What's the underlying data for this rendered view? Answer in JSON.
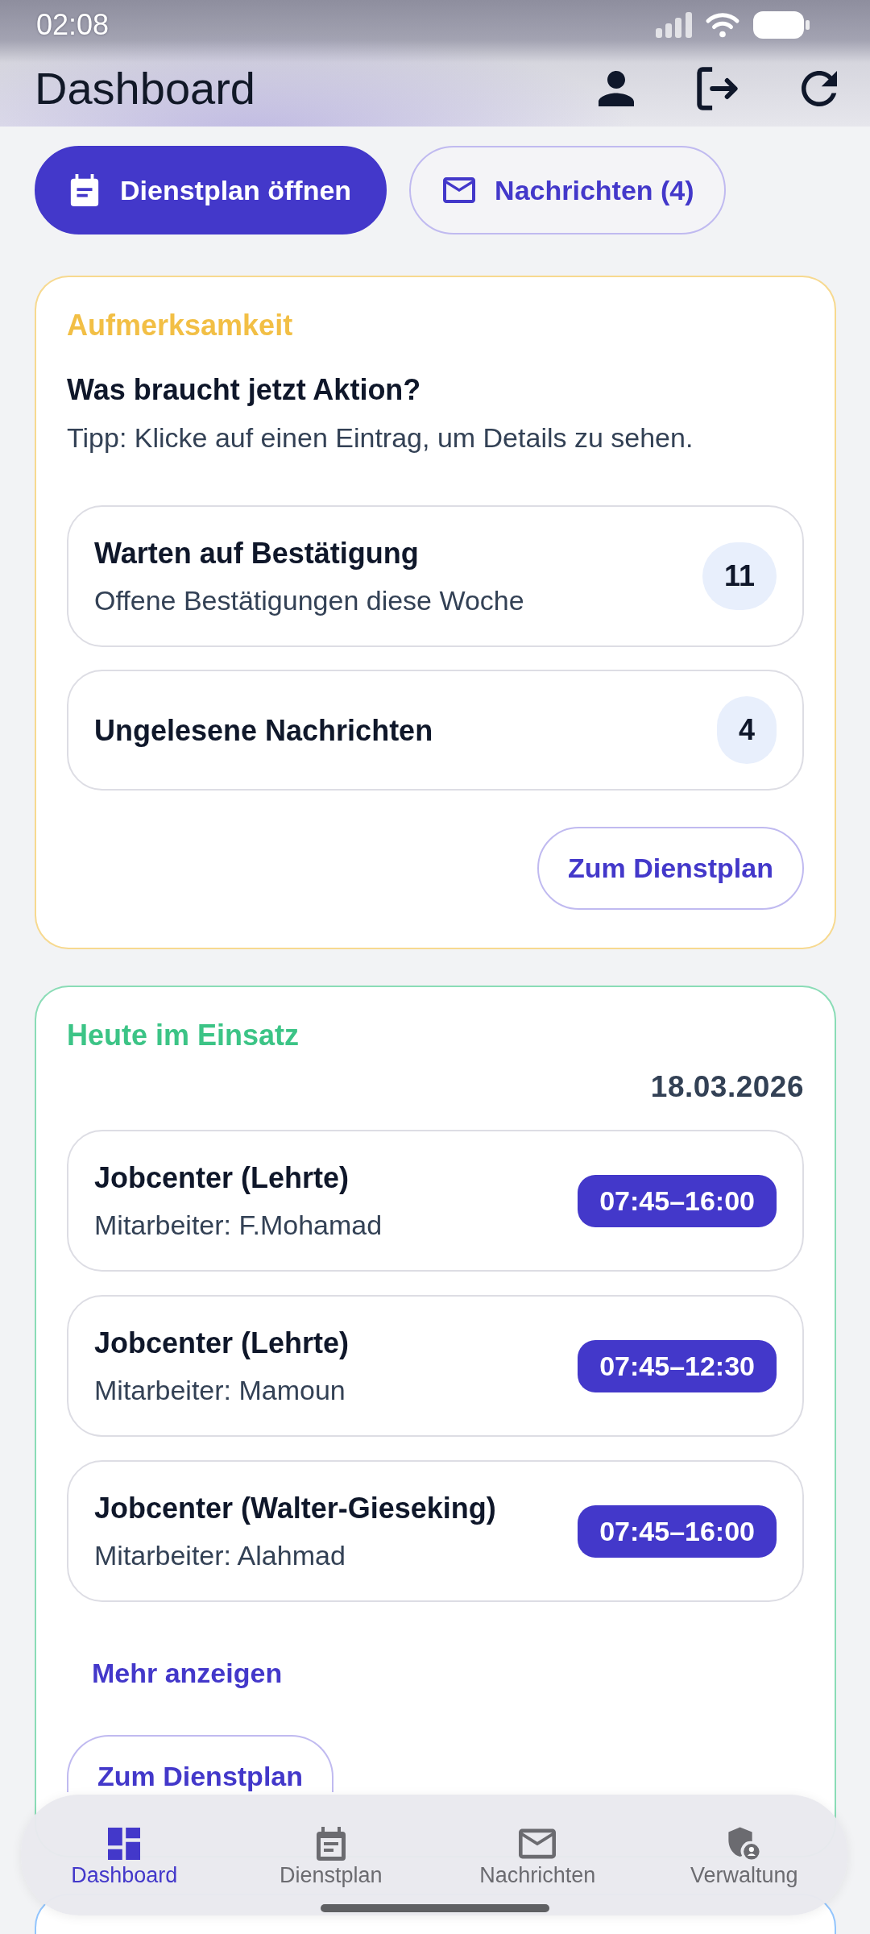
{
  "status_bar": {
    "time": "02:08"
  },
  "app_bar": {
    "title": "Dashboard"
  },
  "quick_actions": [
    {
      "label": "Dienstplan öffnen",
      "kind": "primary"
    },
    {
      "label": "Nachrichten (4)",
      "kind": "outline"
    }
  ],
  "cards": [
    {
      "kind": "attention",
      "color": "#f2bf45",
      "title": "Aufmerksamkeit",
      "heading": "Was braucht jetzt Aktion?",
      "hint": "Tipp: Klicke auf einen Eintrag, um Details zu sehen.",
      "items": [
        {
          "title": "Warten auf Bestätigung",
          "subtitle": "Offene Bestätigungen diese Woche",
          "count": "11"
        },
        {
          "title": "Ungelesene Nachrichten",
          "count": "4"
        }
      ],
      "button": "Zum Dienstplan"
    },
    {
      "kind": "today",
      "color": "#3cc486",
      "title": "Heute im Einsatz",
      "date": "18.03.2026",
      "shifts": [
        {
          "location": "Jobcenter (Lehrte)",
          "employee": "Mitarbeiter: F.Mohamad",
          "time": "07:45–16:00"
        },
        {
          "location": "Jobcenter (Lehrte)",
          "employee": "Mitarbeiter: Mamoun",
          "time": "07:45–12:30"
        },
        {
          "location": "Jobcenter (Walter-Gieseking)",
          "employee": "Mitarbeiter: Alahmad",
          "time": "07:45–16:00"
        }
      ],
      "more_link": "Mehr anzeigen",
      "button": "Zum Dienstplan"
    },
    {
      "kind": "partial",
      "color": "#93c5fd"
    }
  ],
  "bottom_nav": [
    {
      "label": "Dashboard",
      "selected": true
    },
    {
      "label": "Dienstplan",
      "selected": false
    },
    {
      "label": "Nachrichten",
      "selected": false
    },
    {
      "label": "Verwaltung",
      "selected": false
    }
  ]
}
